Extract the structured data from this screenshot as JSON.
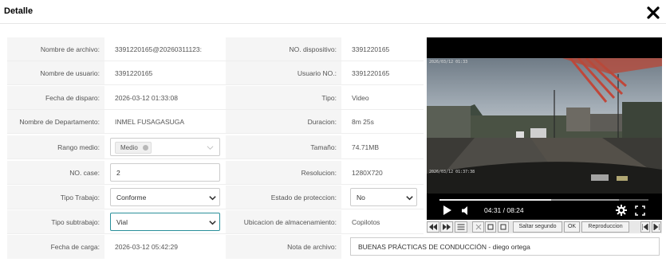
{
  "dialog": {
    "title": "Detalle",
    "close_icon": "close-icon"
  },
  "fields": {
    "nombre_archivo": {
      "label": "Nombre de archivo:",
      "value": "3391220165@20260311123:"
    },
    "no_dispositivo": {
      "label": "NO. dispositivo:",
      "value": "3391220165"
    },
    "nombre_usuario": {
      "label": "Nombre de usuario:",
      "value": "3391220165"
    },
    "usuario_no": {
      "label": "Usuario NO.:",
      "value": "3391220165"
    },
    "fecha_disparo": {
      "label": "Fecha de disparo:",
      "value": "2026-03-12 01:33:08"
    },
    "tipo": {
      "label": "Tipo:",
      "value": "Video"
    },
    "departamento": {
      "label": "Nombre de Departamento:",
      "value": "INMEL FUSAGASUGA"
    },
    "duracion": {
      "label": "Duracion:",
      "value": "8m 25s"
    },
    "rango_medio": {
      "label": "Rango medio:",
      "tag": "Medio"
    },
    "tamano": {
      "label": "Tamaño:",
      "value": "74.71MB"
    },
    "no_case": {
      "label": "NO. case:",
      "value": "2"
    },
    "resolucion": {
      "label": "Resolucion:",
      "value": "1280X720"
    },
    "tipo_trabajo": {
      "label": "Tipo Trabajo:",
      "value": "Conforme"
    },
    "estado_proteccion": {
      "label": "Estado de proteccion:",
      "value": "No"
    },
    "tipo_subtrabajo": {
      "label": "Tipo subtrabajo:",
      "value": "Vial"
    },
    "ubicacion": {
      "label": "Ubicacion de almacenamiento:",
      "value": "Copilotos"
    },
    "fecha_carga": {
      "label": "Fecha de carga:",
      "value": "2026-03-12 05:42:29"
    },
    "nota_archivo": {
      "label": "Nota de archivo:",
      "value": "BUENAS PRÁCTICAS DE CONDUCCIÓN - diego ortega"
    }
  },
  "player": {
    "current_time": "04:31",
    "duration": "08:24",
    "time_display": "04:31 / 08:24",
    "progress_fraction": 0.535,
    "buffered_fraction": 0.86,
    "osd_top": "2026/03/12 01:33",
    "osd_bottom": "2026/03/12 01:37:38"
  },
  "toolbar": {
    "saltar_label": "Saltar segundo",
    "ok_label": "OK",
    "reproduccion_label": "Reproduccion"
  },
  "colors": {
    "active_border": "#2a8f9a",
    "label_bg": "#f5f5f5",
    "sky": "#8e9aa5"
  }
}
